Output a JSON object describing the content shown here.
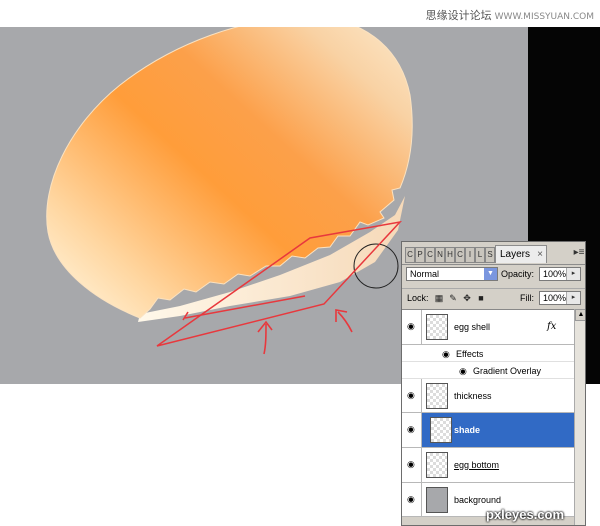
{
  "watermark_top": {
    "cn": "思缘设计论坛",
    "url": "WWW.MISSYUAN.COM"
  },
  "watermark_bottom": "pxleyes.com",
  "panel": {
    "mini_tabs": [
      "C",
      "P",
      "C",
      "N",
      "H",
      "C",
      "I",
      "L",
      "S"
    ],
    "tab_label": "Layers",
    "close_glyph": "×",
    "menu_glyph": "▸≡",
    "blend_mode": "Normal",
    "opacity_label": "Opacity:",
    "opacity_value": "100%",
    "lock_label": "Lock:",
    "fill_label": "Fill:",
    "fill_value": "100%",
    "layers": [
      {
        "name": "egg shell",
        "fx": "fx",
        "effects_label": "Effects",
        "effect": "Gradient Overlay"
      },
      {
        "name": "thickness"
      },
      {
        "name": "shade",
        "selected": true
      },
      {
        "name": "egg bottom"
      },
      {
        "name": "background"
      }
    ]
  },
  "colors": {
    "canvas": "#a7a8ab",
    "selection": "#316ac5",
    "annotation": "#e8383d"
  }
}
